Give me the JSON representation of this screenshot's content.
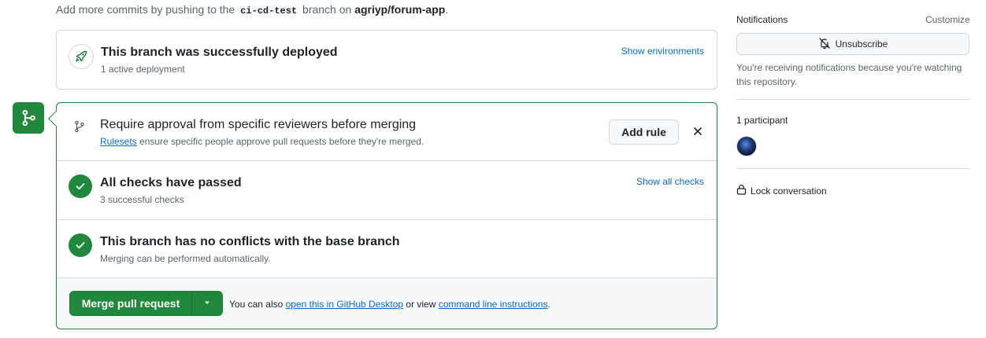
{
  "hint": {
    "prefix": "Add more commits by pushing to the",
    "branch": "ci-cd-test",
    "middle": "branch on",
    "repo": "agriyp/forum-app",
    "suffix": "."
  },
  "deployment": {
    "title": "This branch was successfully deployed",
    "subtitle": "1 active deployment",
    "action": "Show environments",
    "icon": "rocket-icon"
  },
  "approval": {
    "title": "Require approval from specific reviewers before merging",
    "link": "Rulesets",
    "text": "ensure specific people approve pull requests before they're merged.",
    "button": "Add rule",
    "icon": "git-branch-icon"
  },
  "checks": {
    "title": "All checks have passed",
    "subtitle": "3 successful checks",
    "action": "Show all checks"
  },
  "conflicts": {
    "title": "This branch has no conflicts with the base branch",
    "subtitle": "Merging can be performed automatically."
  },
  "merge": {
    "button": "Merge pull request",
    "text_prefix": "You can also",
    "desktop_link": "open this in GitHub Desktop",
    "text_middle": "or view",
    "cli_link": "command line instructions",
    "text_suffix": "."
  },
  "sidebar": {
    "notifications_label": "Notifications",
    "customize": "Customize",
    "unsubscribe": "Unsubscribe",
    "notice": "You're receiving notifications because you're watching this repository.",
    "participants": "1 participant",
    "lock": "Lock conversation"
  },
  "colors": {
    "success": "#1f883d",
    "link": "#0969da",
    "muted": "#59636e",
    "border": "#d1d9e0"
  }
}
